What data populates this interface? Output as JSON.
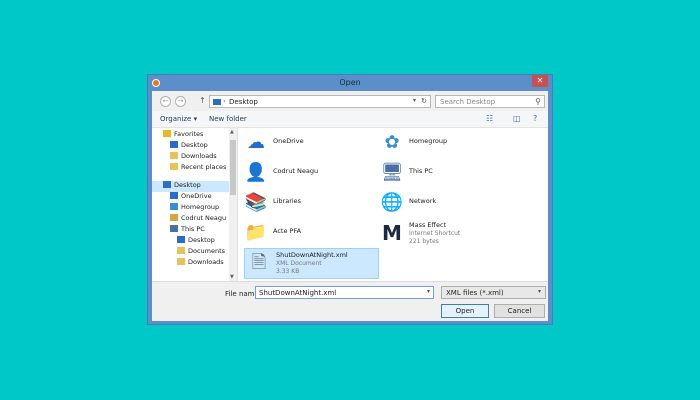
{
  "window": {
    "title": "Open",
    "close_glyph": "✕"
  },
  "address": {
    "back_glyph": "←",
    "forward_glyph": "→",
    "up_glyph": "↑",
    "separator": "›",
    "path": "Desktop",
    "refresh_glyph": "↻",
    "dropdown_glyph": "▾",
    "search_placeholder": "Search Desktop",
    "search_glyph": "⚲"
  },
  "toolbar": {
    "organize_label": "Organize ▾",
    "new_folder_label": "New folder",
    "view_glyph": "☷",
    "pane_glyph": "◫",
    "help_glyph": "?"
  },
  "nav": {
    "items": [
      {
        "label": "Favorites",
        "icon": "star-icon",
        "color": "#e8b923"
      },
      {
        "label": "Desktop",
        "icon": "desktop-icon",
        "color": "#2b6cc4"
      },
      {
        "label": "Downloads",
        "icon": "folder-icon",
        "color": "#e8c15a"
      },
      {
        "label": "Recent places",
        "icon": "folder-icon",
        "color": "#e8c15a"
      },
      {
        "label": "Desktop",
        "icon": "desktop-icon",
        "color": "#2b6cc4",
        "selected": true
      },
      {
        "label": "OneDrive",
        "icon": "cloud-icon",
        "color": "#2b6cc4"
      },
      {
        "label": "Homegroup",
        "icon": "homegroup-icon",
        "color": "#3a8fd1"
      },
      {
        "label": "Codrut Neagu",
        "icon": "user-icon",
        "color": "#d9a441"
      },
      {
        "label": "This PC",
        "icon": "computer-icon",
        "color": "#4a6fa5"
      },
      {
        "label": "Desktop",
        "icon": "desktop-icon",
        "color": "#2b6cc4"
      },
      {
        "label": "Documents",
        "icon": "folder-icon",
        "color": "#e8c15a"
      },
      {
        "label": "Downloads",
        "icon": "folder-icon",
        "color": "#e8c15a"
      }
    ],
    "scroll_up_glyph": "▲",
    "scroll_down_glyph": "▼"
  },
  "files": [
    {
      "name": "OneDrive",
      "glyph": "☁",
      "color": "#1e6fd0"
    },
    {
      "name": "Homegroup",
      "glyph": "✿",
      "color": "#3a8fd1"
    },
    {
      "name": "Codrut Neagu",
      "glyph": "👤",
      "color": "#d9a441"
    },
    {
      "name": "This PC",
      "glyph": "🖥",
      "color": "#4a6fa5"
    },
    {
      "name": "Libraries",
      "glyph": "📚",
      "color": "#e8c15a"
    },
    {
      "name": "Network",
      "glyph": "🌐",
      "color": "#2b6cc4"
    },
    {
      "name": "Acte PFA",
      "glyph": "📁",
      "color": "#e8c15a"
    },
    {
      "name": "Mass Effect",
      "type": "Internet Shortcut",
      "size": "221 bytes",
      "glyph": "M",
      "color": "#1a2a40"
    },
    {
      "name": "ShutDownAtNight.xml",
      "type": "XML Document",
      "size": "3.33 KB",
      "glyph": "🗎",
      "color": "#666666",
      "selected": true
    }
  ],
  "bottom": {
    "file_name_label": "File name:",
    "file_name_value": "ShutDownAtNight.xml",
    "dropdown_glyph": "▾",
    "filter_value": "XML files (*.xml)",
    "open_label": "Open",
    "cancel_label": "Cancel"
  }
}
